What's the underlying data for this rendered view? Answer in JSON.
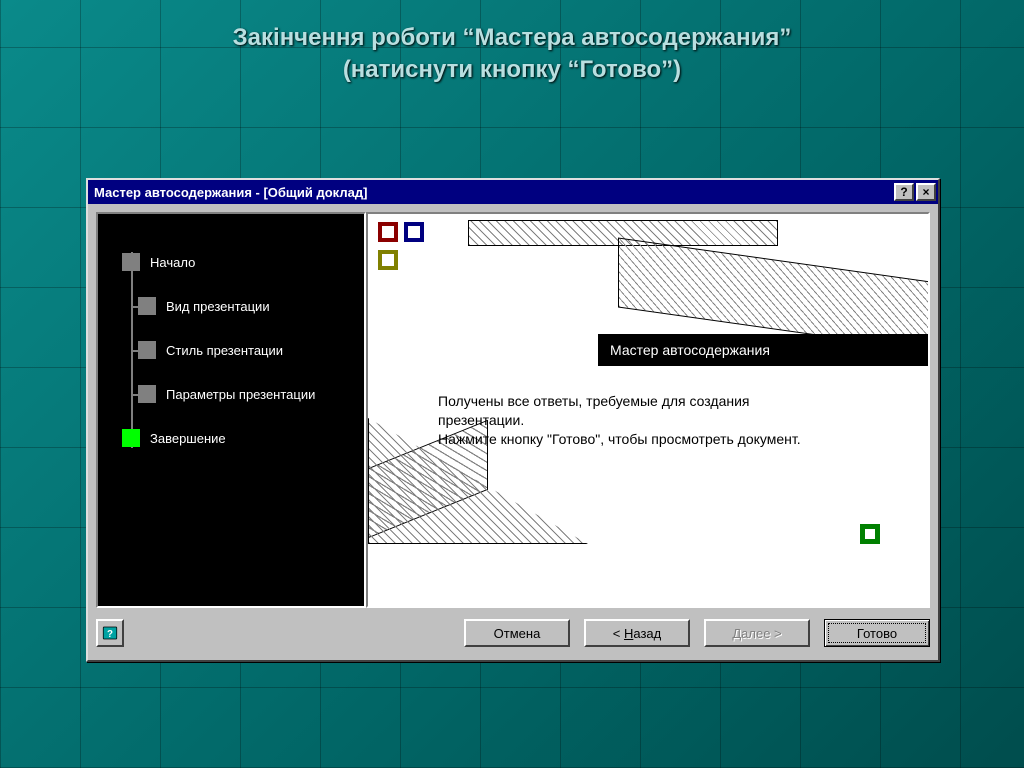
{
  "slide": {
    "title_line1": "Закінчення роботи “Мастера автосодержания”",
    "title_line2": "(натиснути кнопку “Готово”)"
  },
  "window": {
    "title": "Мастер автосодержания - [Общий доклад]",
    "help_glyph": "?",
    "close_glyph": "×"
  },
  "nav": {
    "items": [
      {
        "label": "Начало",
        "sub": false,
        "active": false
      },
      {
        "label": "Вид презентации",
        "sub": true,
        "active": false
      },
      {
        "label": "Стиль презентации",
        "sub": true,
        "active": false
      },
      {
        "label": "Параметры презентации",
        "sub": true,
        "active": false
      },
      {
        "label": "Завершение",
        "sub": false,
        "active": true
      }
    ]
  },
  "content": {
    "banner": "Мастер автосодержания",
    "message_line1": "Получены все ответы, требуемые для создания презентации.",
    "message_line2": "Нажмите кнопку \"Готово\", чтобы просмотреть документ."
  },
  "buttons": {
    "cancel": "Отмена",
    "back_prefix": "< ",
    "back_u": "Н",
    "back_rest": "азад",
    "next_u": "Д",
    "next_rest": "алее >",
    "finish": "Готово"
  }
}
